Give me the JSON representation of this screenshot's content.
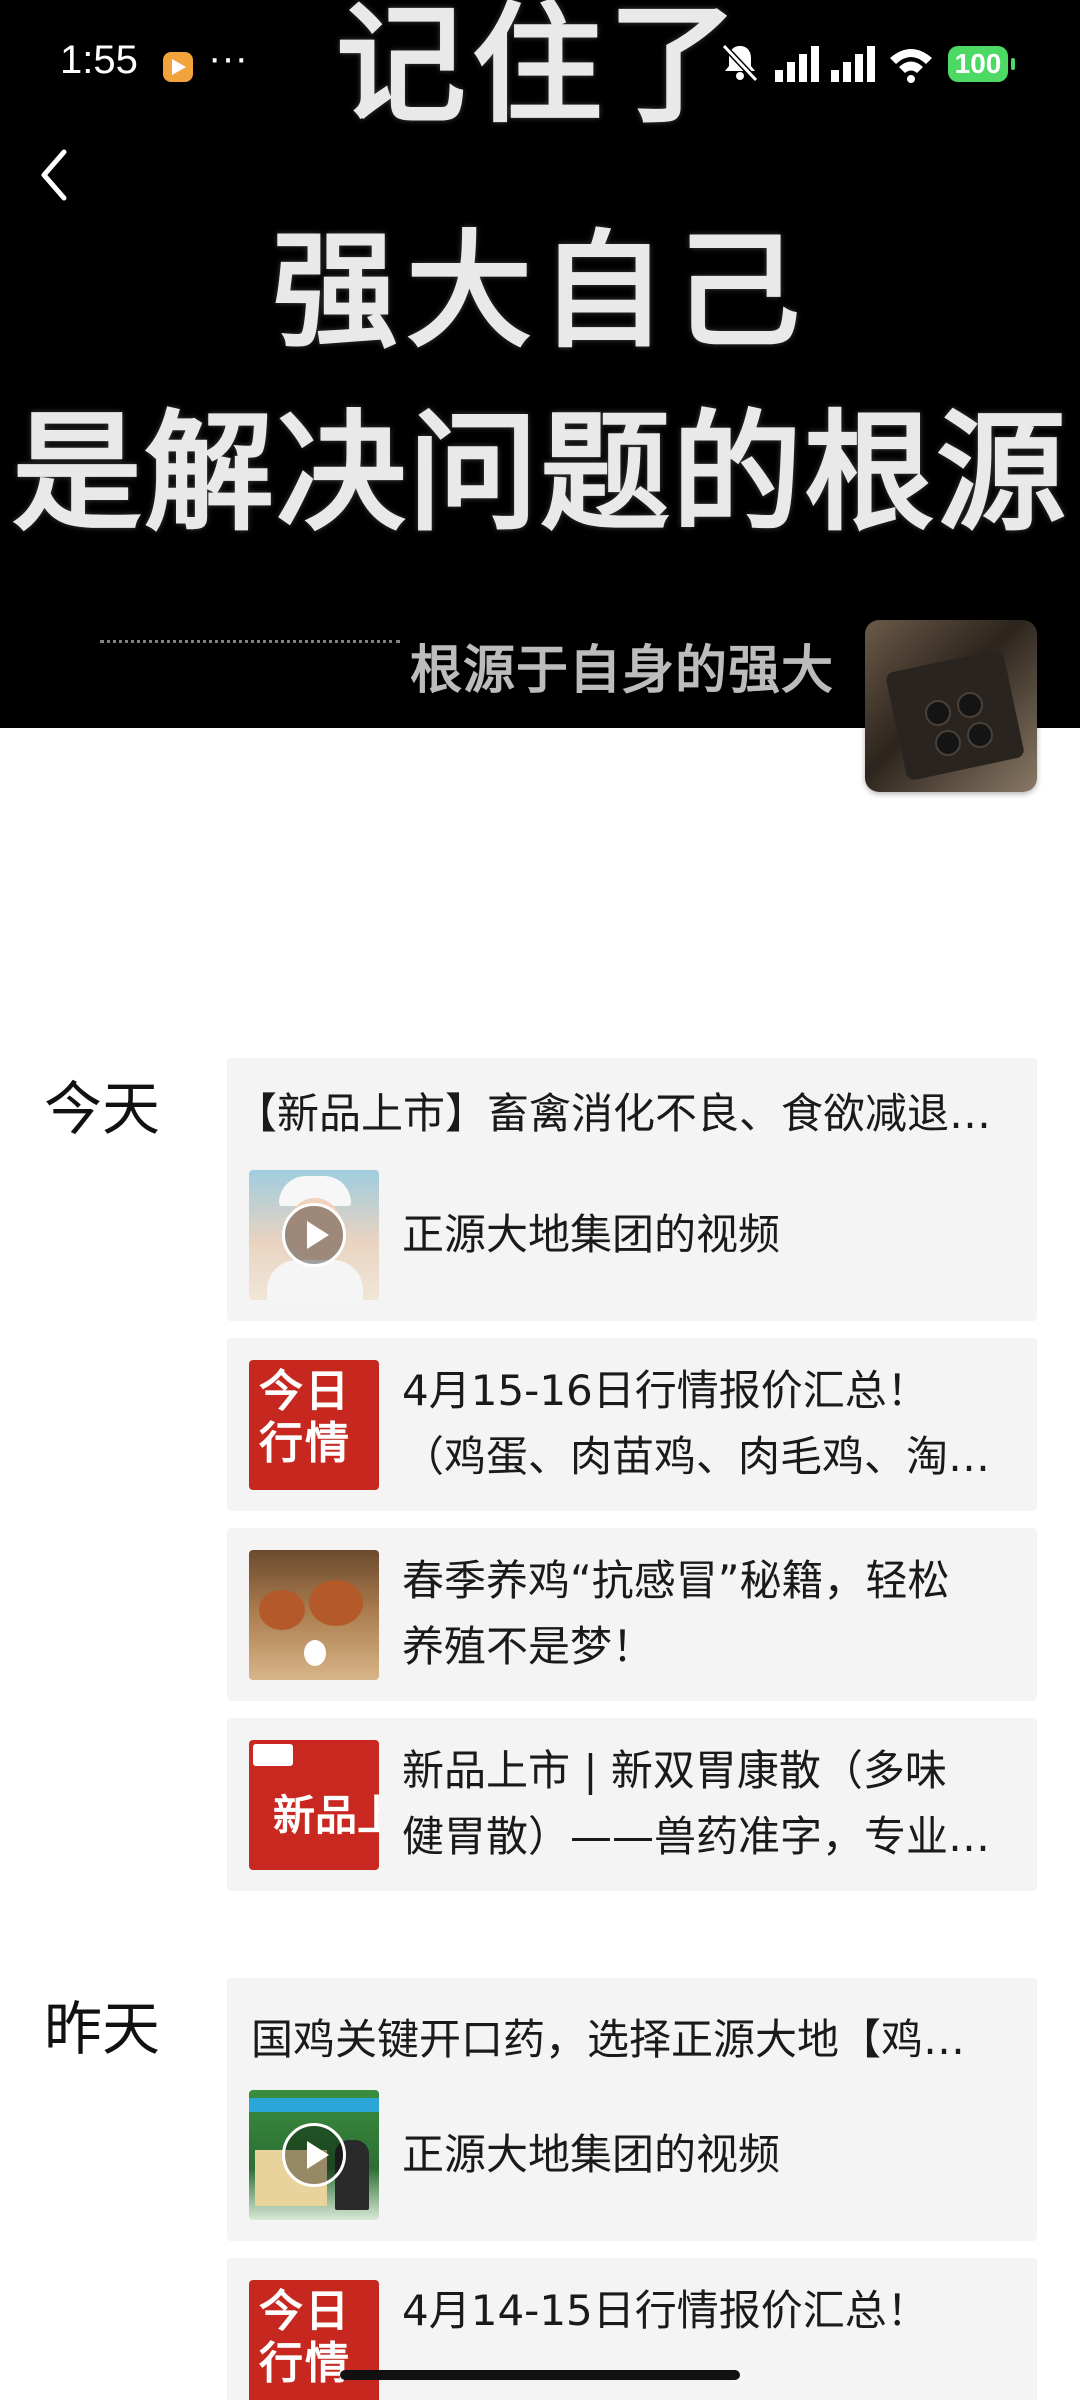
{
  "status_bar": {
    "time": "1:55",
    "more": "···",
    "battery": "100"
  },
  "hero": {
    "line1": "记住了",
    "line2": "强大自己",
    "line3": "是解决问题的根源",
    "caption": "根源于自身的强大"
  },
  "sections": [
    {
      "label": "今天",
      "cards": [
        {
          "title": "【新品上市】畜禽消化不良、食欲减退的…",
          "text": "正源大地集团的视频"
        },
        {
          "image_text": "今日\n行情",
          "line1": "4月15-16日行情报价汇总！",
          "line2": "（鸡蛋、肉苗鸡、肉毛鸡、淘汰鸡）"
        },
        {
          "line1": "春季养鸡“抗感冒”秘籍，轻松",
          "line2": "养殖不是梦！"
        },
        {
          "image_text": "新品上市",
          "line1": "新品上市 | 新双胃康散（多味",
          "line2": "健胃散）——兽药准字，专业解决"
        }
      ]
    },
    {
      "label": "昨天",
      "cards": [
        {
          "title": "国鸡关键开口药，选择正源大地【鸡用】",
          "text": "正源大地集团的视频"
        },
        {
          "image_text": "今日\n行情",
          "line1": "4月14-15日行情报价汇总！"
        }
      ]
    }
  ],
  "colors": {
    "card_bg": "#f4f4f4",
    "battery": "#4cd964",
    "hero_bg": "#000000",
    "news_red": "#c6281f"
  }
}
